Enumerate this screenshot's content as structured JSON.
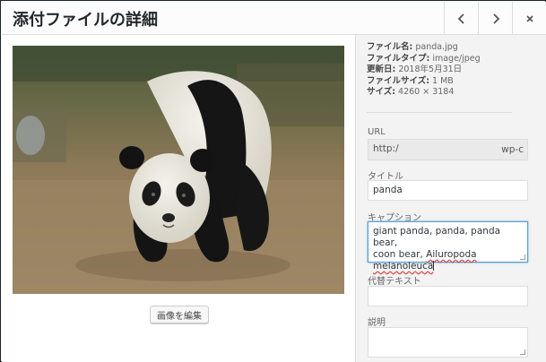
{
  "header": {
    "title": "添付ファイルの詳細",
    "prev_icon": "chevron-left-icon",
    "next_icon": "chevron-right-icon",
    "close_icon": "close-icon"
  },
  "image": {
    "alt": "giant panda walking on dirt ground",
    "edit_label": "画像を編集"
  },
  "meta": {
    "filename_label": "ファイル名:",
    "filename": "panda.jpg",
    "filetype_label": "ファイルタイプ:",
    "filetype": "image/jpeg",
    "updated_label": "更新日:",
    "updated": "2018年5月31日",
    "filesize_label": "ファイルサイズ:",
    "filesize": "1 MB",
    "dimensions_label": "サイズ:",
    "dimensions": "4260 × 3184"
  },
  "fields": {
    "url_label": "URL",
    "url_start": "http:/",
    "url_end": "wp-c",
    "title_label": "タイトル",
    "title_value": "panda",
    "caption_label": "キャプション",
    "caption_line1": "giant panda, panda, panda bear,",
    "caption_line2_a": "coon bear, ",
    "caption_line2_b": "Ailuropoda melanoleuca",
    "alt_label": "代替テキスト",
    "alt_value": "",
    "description_label": "説明",
    "description_value": ""
  },
  "colors": {
    "focus_border": "#5b9dd9",
    "sidebar_bg": "#f3f3f3"
  }
}
